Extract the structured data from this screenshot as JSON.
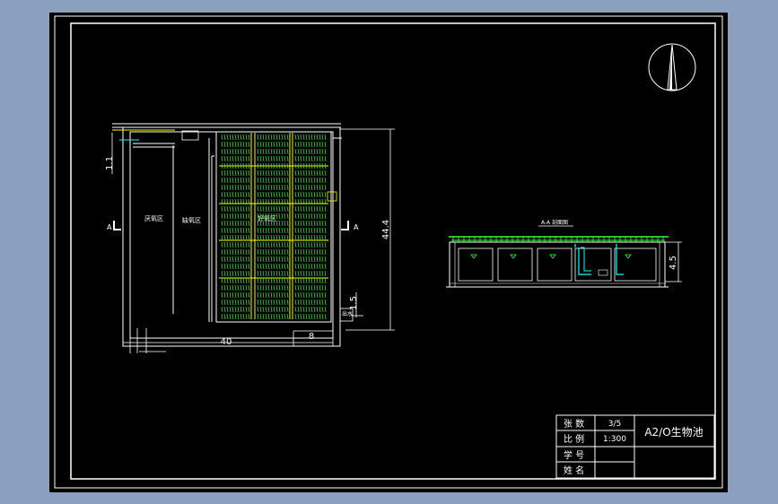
{
  "plan": {
    "zone_anaerobic": "厌氧区",
    "zone_anoxic": "缺氧区",
    "zone_aerobic": "好氧区",
    "dim_length": "40",
    "dim_small": "8",
    "dim_height": "44.4",
    "dim_top_left": "1.1",
    "dim_bottom_right": "1.5",
    "section_mark_left": "A",
    "section_mark_right": "A",
    "outlet_label": "出水"
  },
  "section": {
    "title": "A-A 剖面图",
    "dim_depth": "4.5"
  },
  "title_block": {
    "sheet_label": "张 数",
    "sheet_value": "3/5",
    "scale_label": "比 例",
    "scale_value": "1:300",
    "student_id_label": "学 号",
    "name_label": "姓 名",
    "drawing_title": "A2/O生物池"
  },
  "colors": {
    "frame": "#ffffff",
    "aeration": "#33ff33",
    "divider": "#ffff00",
    "pipe": "#00ffff",
    "background": "#000000",
    "outer": "#8b9fbf"
  }
}
